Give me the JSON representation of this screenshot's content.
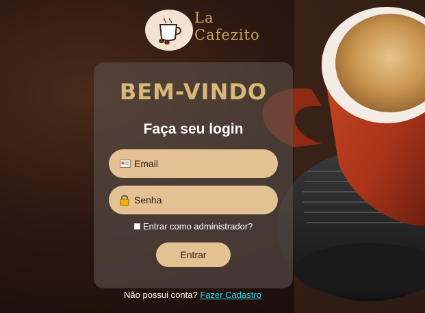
{
  "brand": {
    "line1": "La",
    "line2": "Cafezito",
    "accent_color": "#c9a55c"
  },
  "login": {
    "welcome": "BEM-VINDO",
    "subtitle": "Faça seu login",
    "email_placeholder": "Email",
    "password_placeholder": "Senha",
    "admin_label": "Entrar como administrador?",
    "admin_checked": false,
    "submit_label": "Entrar"
  },
  "footer": {
    "question": "Não possui conta?",
    "signup_link": "Fazer Cadastro"
  },
  "colors": {
    "field_bg": "#e3c193",
    "link": "#28d3ea",
    "welcome": "#d9b877"
  },
  "icons": {
    "email": "email-card-icon",
    "password": "padlock-icon",
    "logo": "coffee-cup-icon"
  }
}
